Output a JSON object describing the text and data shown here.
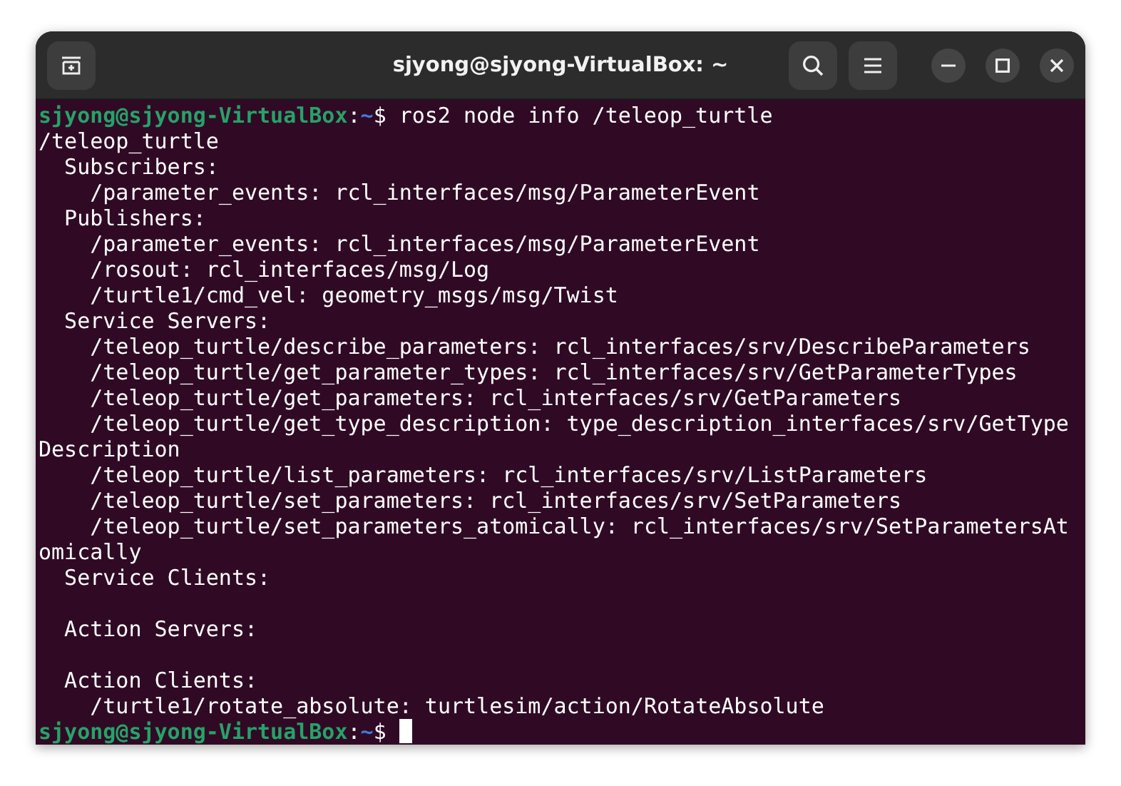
{
  "window": {
    "title": "sjyong@sjyong-VirtualBox: ~"
  },
  "terminal": {
    "cursor": true,
    "lines": [
      {
        "kind": "prompt",
        "user_host": "sjyong@sjyong-VirtualBox",
        "colon": ":",
        "path": "~",
        "sigil": "$",
        "command": "ros2 node info /teleop_turtle"
      },
      {
        "kind": "output",
        "text": "/teleop_turtle"
      },
      {
        "kind": "output",
        "text": "  Subscribers:"
      },
      {
        "kind": "output",
        "text": "    /parameter_events: rcl_interfaces/msg/ParameterEvent"
      },
      {
        "kind": "output",
        "text": "  Publishers:"
      },
      {
        "kind": "output",
        "text": "    /parameter_events: rcl_interfaces/msg/ParameterEvent"
      },
      {
        "kind": "output",
        "text": "    /rosout: rcl_interfaces/msg/Log"
      },
      {
        "kind": "output",
        "text": "    /turtle1/cmd_vel: geometry_msgs/msg/Twist"
      },
      {
        "kind": "output",
        "text": "  Service Servers:"
      },
      {
        "kind": "output",
        "text": "    /teleop_turtle/describe_parameters: rcl_interfaces/srv/DescribeParameters"
      },
      {
        "kind": "output",
        "text": "    /teleop_turtle/get_parameter_types: rcl_interfaces/srv/GetParameterTypes"
      },
      {
        "kind": "output",
        "text": "    /teleop_turtle/get_parameters: rcl_interfaces/srv/GetParameters"
      },
      {
        "kind": "output",
        "text": "    /teleop_turtle/get_type_description: type_description_interfaces/srv/GetType"
      },
      {
        "kind": "output",
        "text": "Description"
      },
      {
        "kind": "output",
        "text": "    /teleop_turtle/list_parameters: rcl_interfaces/srv/ListParameters"
      },
      {
        "kind": "output",
        "text": "    /teleop_turtle/set_parameters: rcl_interfaces/srv/SetParameters"
      },
      {
        "kind": "output",
        "text": "    /teleop_turtle/set_parameters_atomically: rcl_interfaces/srv/SetParametersAt"
      },
      {
        "kind": "output",
        "text": "omically"
      },
      {
        "kind": "output",
        "text": "  Service Clients:"
      },
      {
        "kind": "blank"
      },
      {
        "kind": "output",
        "text": "  Action Servers:"
      },
      {
        "kind": "blank"
      },
      {
        "kind": "output",
        "text": "  Action Clients:"
      },
      {
        "kind": "output",
        "text": "    /turtle1/rotate_absolute: turtlesim/action/RotateAbsolute"
      },
      {
        "kind": "prompt",
        "user_host": "sjyong@sjyong-VirtualBox",
        "colon": ":",
        "path": "~",
        "sigil": "$"
      }
    ]
  }
}
